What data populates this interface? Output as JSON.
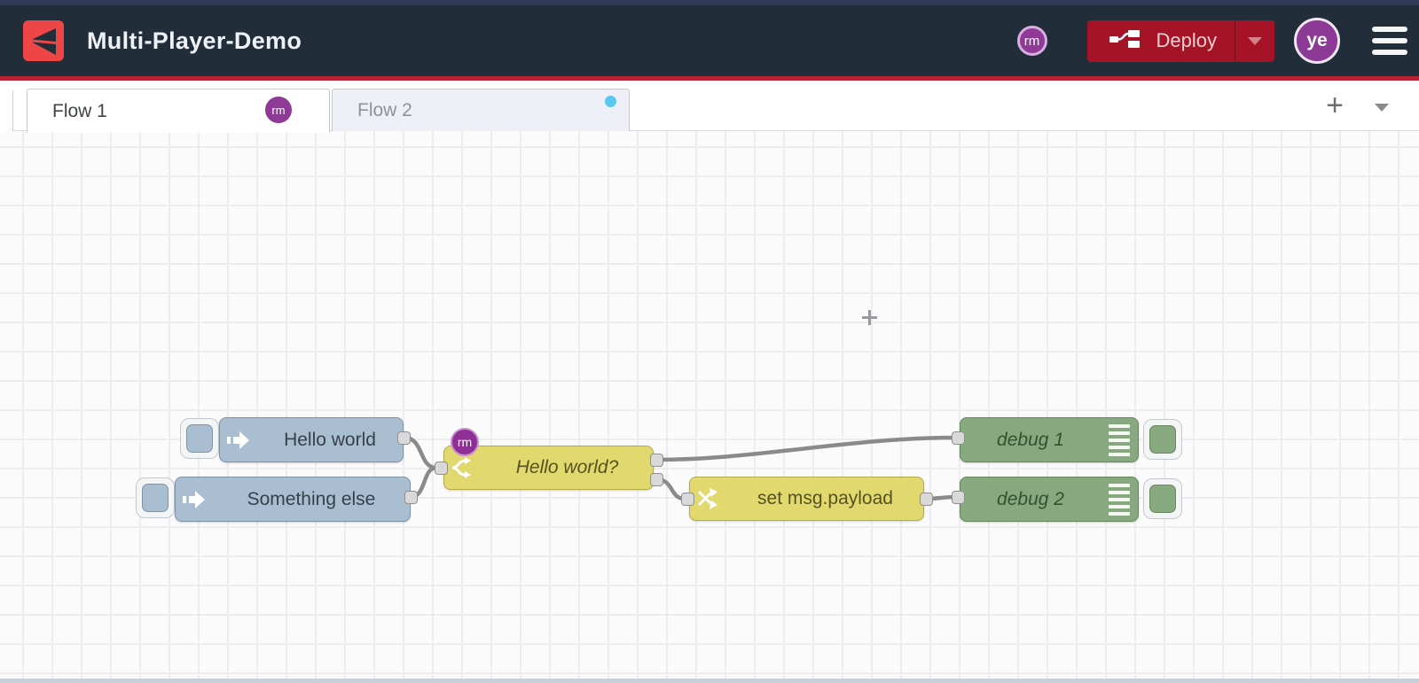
{
  "header": {
    "title": "Multi-Player-Demo",
    "deploy_label": "Deploy",
    "collaborator_badge": "rm",
    "user_initials": "ye"
  },
  "tabs": {
    "items": [
      {
        "label": "Flow 1",
        "badge": "rm",
        "active": true
      },
      {
        "label": "Flow 2",
        "active": false
      }
    ],
    "add_label": "+"
  },
  "nodes": {
    "inject1": {
      "type": "inject",
      "label": "Hello world"
    },
    "inject2": {
      "type": "inject",
      "label": "Something else"
    },
    "switch1": {
      "type": "switch",
      "label": "Hello world?",
      "badge": "rm"
    },
    "change1": {
      "type": "change",
      "label": "set msg.payload"
    },
    "debug1": {
      "type": "debug",
      "label": "debug 1"
    },
    "debug2": {
      "type": "debug",
      "label": "debug 2"
    }
  },
  "colors": {
    "header_bg": "#222d3a",
    "accent_red_line": "#b92135",
    "deploy_red": "#a41426",
    "brand_logo_red": "#ee4647",
    "collab_purple": "#8e3a96",
    "inject_blue": "#a9bed0",
    "function_yellow": "#e2d96e",
    "debug_green": "#87a980",
    "wire_grey": "#8a8a8a",
    "grid_line": "#ededf0",
    "canvas_bg": "#fbfbfc",
    "port_grey": "#d9d9d9",
    "flow2_status_dot": "#5bc7f0"
  }
}
